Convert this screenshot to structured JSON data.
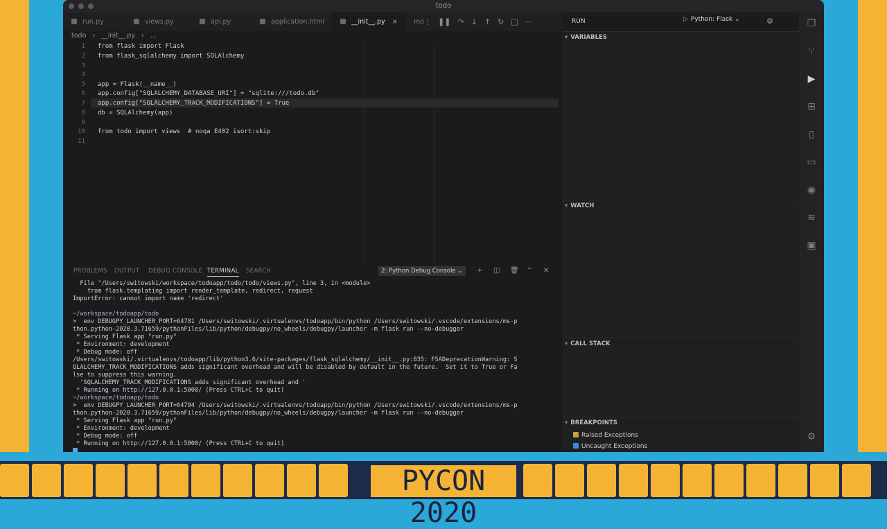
{
  "window": {
    "title": "todo"
  },
  "tabs": [
    {
      "label": "run.py",
      "active": false
    },
    {
      "label": "views.py",
      "active": false
    },
    {
      "label": "api.py",
      "active": false
    },
    {
      "label": "application.html",
      "active": false
    },
    {
      "label": "__init__.py",
      "active": true
    },
    {
      "label": "mo",
      "active": false
    }
  ],
  "breadcrumb": [
    "todo",
    "__init__.py",
    "..."
  ],
  "editor": {
    "line_numbers": [
      "1",
      "2",
      "3",
      "4",
      "5",
      "6",
      "7",
      "8",
      "9",
      "10",
      "11"
    ],
    "lines": [
      "from flask import Flask",
      "from flask_sqlalchemy import SQLAlchemy",
      "",
      "",
      "app = Flask(__name__)",
      "app.config[\"SQLALCHEMY_DATABASE_URI\"] = \"sqlite:///todo.db\"",
      "app.config[\"SQLALCHEMY_TRACK_MODIFICATIONS\"] = True",
      "db = SQLAlchemy(app)",
      "",
      "from todo import views  # noqa E402 isort:skip",
      ""
    ]
  },
  "panel": {
    "tabs": [
      "PROBLEMS",
      "OUTPUT",
      "DEBUG CONSOLE",
      "TERMINAL",
      "SEARCH"
    ],
    "active_tab": "TERMINAL",
    "terminal_select": "2: Python Debug Console",
    "terminal_lines": [
      "  File \"/Users/switowski/workspace/todoapp/todo/todo/views.py\", line 3, in <module>",
      "    from flask.templating import render_template, redirect, request",
      "ImportError: cannot import name 'redirect'",
      "",
      "~/workspace/todoapp/todo",
      ">  env DEBUGPY_LAUNCHER_PORT=64781 /Users/switowski/.virtualenvs/todoapp/bin/python /Users/switowski/.vscode/extensions/ms-p",
      "thon.python-2020.3.71659/pythonFiles/lib/python/debugpy/no_wheels/debugpy/launcher -m flask run --no-debugger",
      " * Serving Flask app \"run.py\"",
      " * Environment: development",
      " * Debug mode: off",
      "/Users/switowski/.virtualenvs/todoapp/lib/python3.6/site-packages/flask_sqlalchemy/__init__.py:835: FSADeprecationWarning: S",
      "QLALCHEMY_TRACK_MODIFICATIONS adds significant overhead and will be disabled by default in the future.  Set it to True or Fa",
      "lse to suppress this warning.",
      "  'SQLALCHEMY_TRACK_MODIFICATIONS adds significant overhead and '",
      " * Running on http://127.0.0.1:5000/ (Press CTRL+C to quit)",
      "~/workspace/todoapp/todo",
      ">  env DEBUGPY_LAUNCHER_PORT=64794 /Users/switowski/.virtualenvs/todoapp/bin/python /Users/switowski/.vscode/extensions/ms-p",
      "thon.python-2020.3.71659/pythonFiles/lib/python/debugpy/no_wheels/debugpy/launcher -m flask run --no-debugger",
      " * Serving Flask app \"run.py\"",
      " * Environment: development",
      " * Debug mode: off",
      " * Running on http://127.0.0.1:5000/ (Press CTRL+C to quit)"
    ]
  },
  "run": {
    "label": "RUN",
    "config": "Python: Flask"
  },
  "sidebar": {
    "variables": "VARIABLES",
    "watch": "WATCH",
    "call_stack": "CALL STACK",
    "breakpoints": "BREAKPOINTS",
    "breakpoint_items": [
      {
        "label": "Raised Exceptions",
        "color": "#c9a040"
      },
      {
        "label": "Uncaught Exceptions",
        "color": "#2f8fd8"
      }
    ]
  },
  "footer": {
    "brand": "PYCON 2020"
  },
  "colors": {
    "accent": "#4aa8ff",
    "frame": "#2aa8d8",
    "pycon": "#f4b332"
  }
}
